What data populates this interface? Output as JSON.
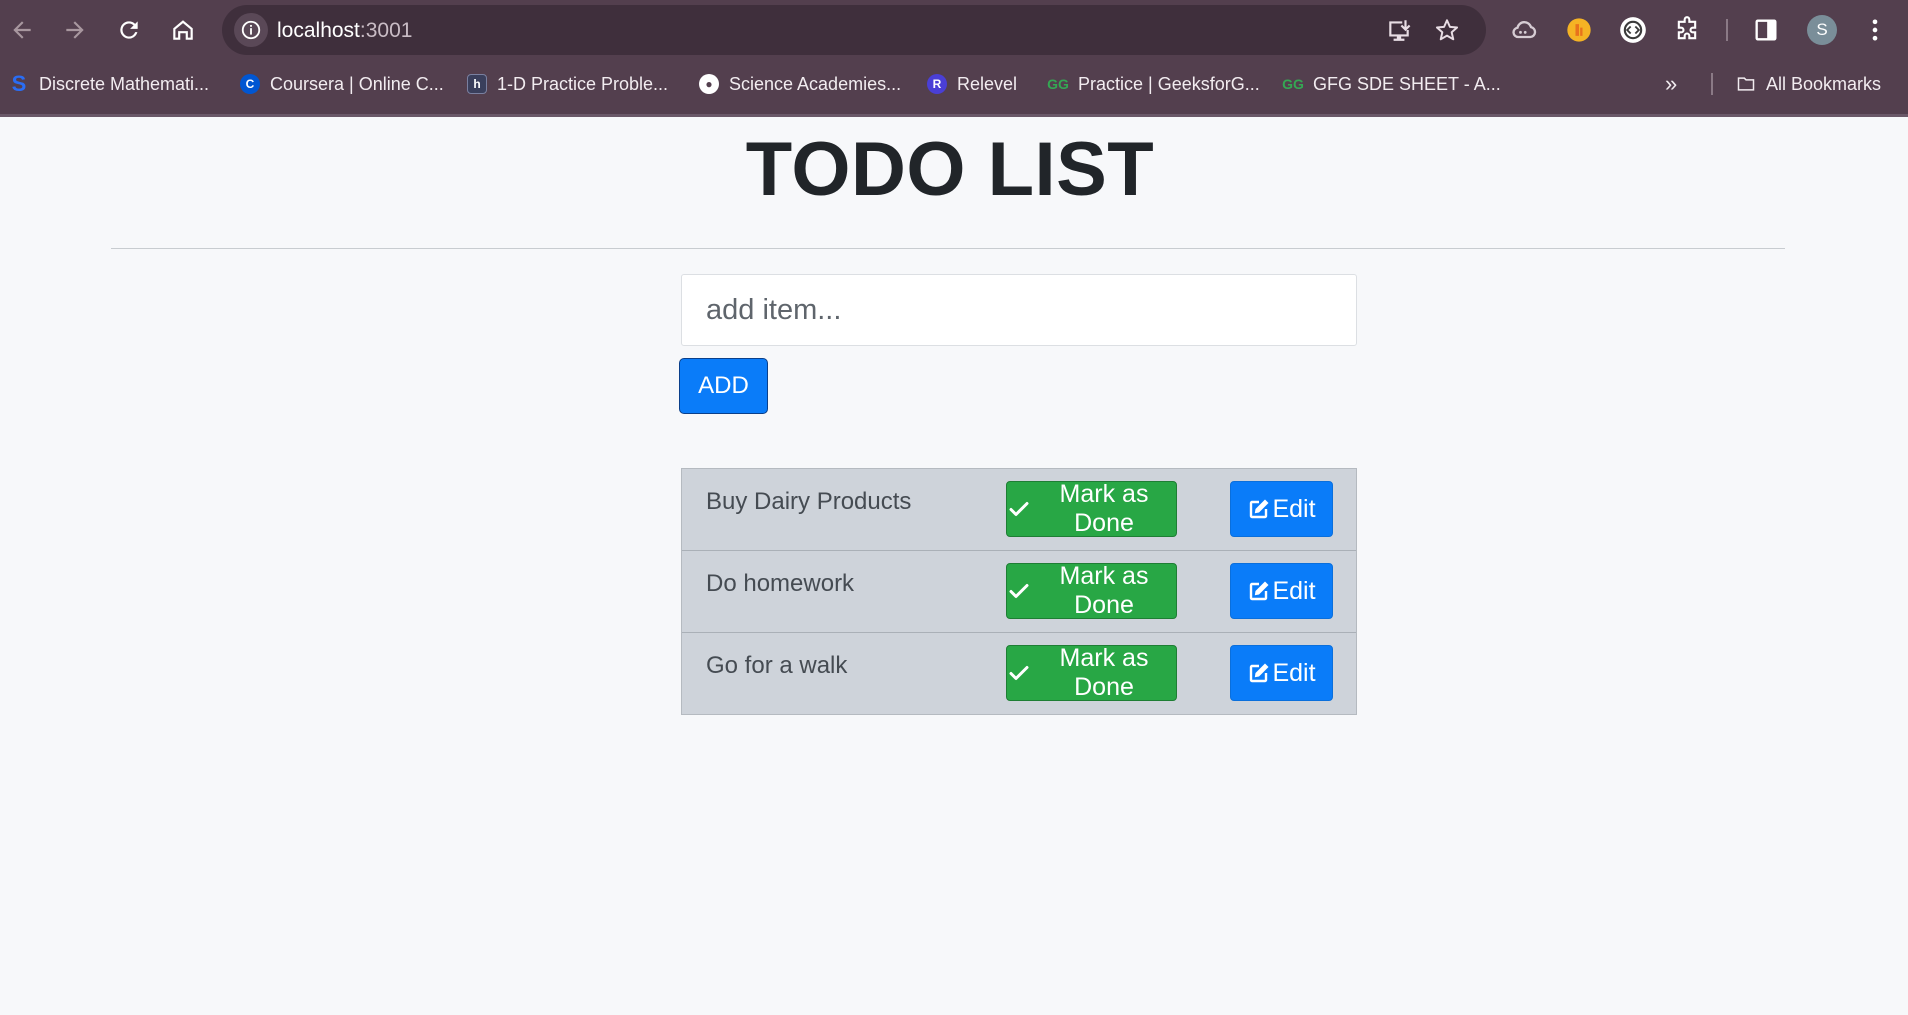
{
  "browser": {
    "url_host": "localhost",
    "url_port": ":3001",
    "avatar_letter": "S",
    "bookmarks": [
      {
        "label": "Discrete Mathemati...",
        "icon": "bookmark-s-icon",
        "color": "#2a6df4"
      },
      {
        "label": "Coursera | Online C...",
        "icon": "coursera-icon",
        "color": "#0056d2"
      },
      {
        "label": "1-D Practice Proble...",
        "icon": "hackerrank-h-icon",
        "color": "#3a3f5c"
      },
      {
        "label": "Science Academies...",
        "icon": "globe-icon",
        "color": "#ffffff"
      },
      {
        "label": "Relevel",
        "icon": "relevel-r-icon",
        "color": "#4a3fd6"
      },
      {
        "label": "Practice | GeeksforG...",
        "icon": "gfg-icon",
        "color": "#2f8d46"
      },
      {
        "label": "GFG SDE SHEET - A...",
        "icon": "gfg-icon",
        "color": "#2f8d46"
      }
    ],
    "all_bookmarks_label": "All Bookmarks"
  },
  "page": {
    "title": "TODO LIST",
    "input_placeholder": "add item...",
    "add_label": "ADD"
  },
  "todos": [
    {
      "text": "Buy Dairy Products",
      "done_label": "Mark as Done",
      "edit_label": "Edit"
    },
    {
      "text": "Do homework",
      "done_label": "Mark as Done",
      "edit_label": "Edit"
    },
    {
      "text": "Go for a walk",
      "done_label": "Mark as Done",
      "edit_label": "Edit"
    }
  ],
  "colors": {
    "primary": "#0a7cf9",
    "success": "#28a745",
    "list_bg": "#ced3da",
    "chrome": "#533f4e"
  }
}
